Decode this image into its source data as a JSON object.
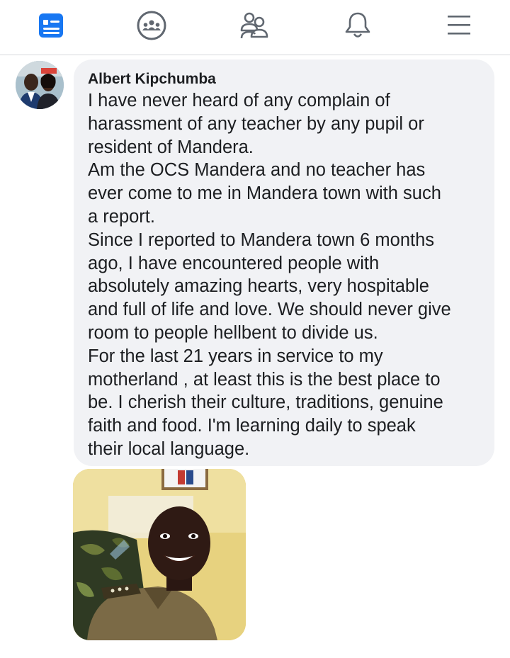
{
  "navbar": {
    "items": [
      {
        "icon": "news-feed-icon",
        "active": true
      },
      {
        "icon": "groups-icon",
        "active": false
      },
      {
        "icon": "friends-icon",
        "active": false
      },
      {
        "icon": "notifications-bell-icon",
        "active": false
      },
      {
        "icon": "menu-icon",
        "active": false
      }
    ],
    "active_color": "#1877f2",
    "inactive_color": "#606770"
  },
  "comment": {
    "author": "Albert Kipchumba",
    "text": "I have never heard of any complain of\nharassment of any teacher by any pupil or\nresident of Mandera.\nAm the OCS Mandera and no teacher has\never come to me in Mandera town with such\na report.\nSince I reported to Mandera town 6 months\nago, I have encountered people with\nabsolutely amazing hearts, very hospitable\nand full of life and love. We should never give\nroom to people hellbent to divide us.\nFor the last 21 years in service to my\nmotherland , at least this is the best place to\nbe. I cherish their culture, traditions, genuine\nfaith and food. I'm learning daily to speak\ntheir local language.",
    "bubble_color": "#f1f2f5"
  }
}
